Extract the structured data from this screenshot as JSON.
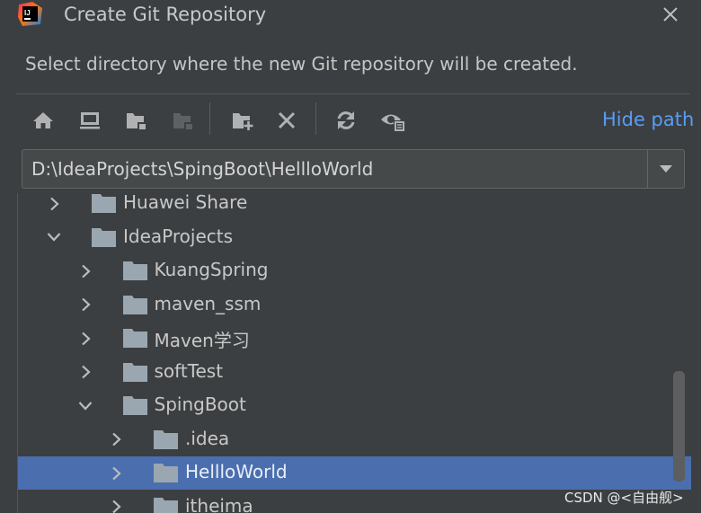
{
  "dialog": {
    "title": "Create Git Repository",
    "description": "Select directory where the new Git repository will be created.",
    "logo_text": "IJ"
  },
  "toolbar": {
    "icons": [
      "home-icon",
      "desktop-icon",
      "project-folder-icon",
      "module-folder-icon",
      "new-folder-icon",
      "delete-icon",
      "refresh-icon",
      "show-hidden-icon"
    ],
    "hide_path_label": "Hide path"
  },
  "path": {
    "value": "D:\\IdeaProjects\\SpingBoot\\HellloWorld"
  },
  "tree": {
    "rows": [
      {
        "label": "Huawei Share",
        "expanded": false,
        "selected": false
      },
      {
        "label": "IdeaProjects",
        "expanded": true,
        "selected": false
      },
      {
        "label": "KuangSpring",
        "expanded": false,
        "selected": false
      },
      {
        "label": "maven_ssm",
        "expanded": false,
        "selected": false
      },
      {
        "label": "Maven学习",
        "expanded": false,
        "selected": false
      },
      {
        "label": "softTest",
        "expanded": false,
        "selected": false
      },
      {
        "label": "SpingBoot",
        "expanded": true,
        "selected": false
      },
      {
        "label": ".idea",
        "expanded": false,
        "selected": false
      },
      {
        "label": "HellloWorld",
        "expanded": false,
        "selected": true
      },
      {
        "label": "itheima",
        "expanded": false,
        "selected": false
      }
    ]
  },
  "colors": {
    "background": "#3c3f41",
    "accent_link": "#589df6",
    "selection": "#4b6eaf",
    "folder": "#9aa7b0"
  },
  "watermark": "CSDN @<自由舰>"
}
